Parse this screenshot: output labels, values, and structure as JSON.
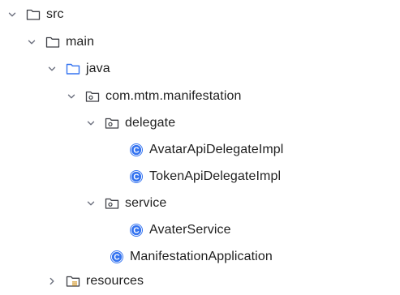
{
  "tree": {
    "rows": [
      {
        "label": "src",
        "icon": "folder-icon",
        "expanded": true
      },
      {
        "label": "main",
        "icon": "folder-icon",
        "expanded": true
      },
      {
        "label": "java",
        "icon": "source-folder-icon",
        "expanded": true
      },
      {
        "label": "com.mtm.manifestation",
        "icon": "package-icon",
        "expanded": true
      },
      {
        "label": "delegate",
        "icon": "package-icon",
        "expanded": true
      },
      {
        "label": "AvatarApiDelegateImpl",
        "icon": "class-icon"
      },
      {
        "label": "TokenApiDelegateImpl",
        "icon": "class-icon"
      },
      {
        "label": "service",
        "icon": "package-icon",
        "expanded": true
      },
      {
        "label": "AvaterService",
        "icon": "class-icon"
      },
      {
        "label": "ManifestationApplication",
        "icon": "class-icon"
      },
      {
        "label": "resources",
        "icon": "resources-folder-icon",
        "expanded": false
      }
    ]
  },
  "colors": {
    "folder_stroke": "#3d3f45",
    "source_folder_stroke": "#3574f0",
    "class_fill": "#3574f0",
    "chevron": "#6c707e",
    "text": "#1f1f1f",
    "resources_stripes": "#d9a443"
  }
}
